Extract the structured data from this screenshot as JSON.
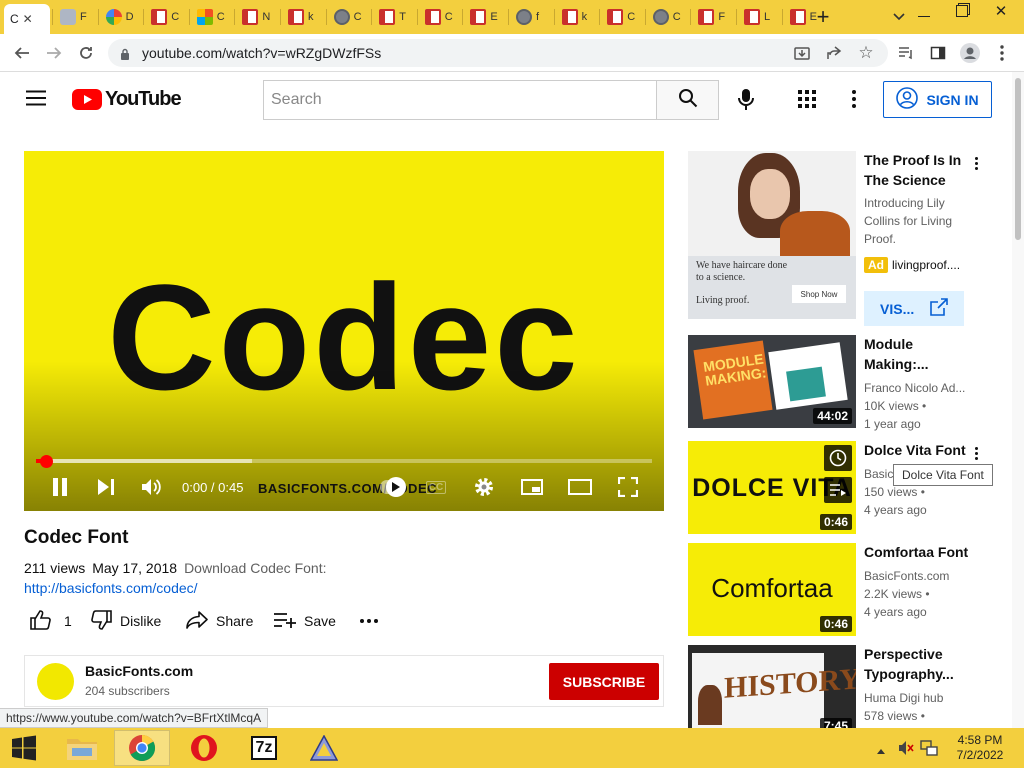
{
  "browser": {
    "url": "youtube.com/watch?v=wRZgDWzfFSs",
    "active_tab_label": "C",
    "tabs": [
      {
        "icon": "doc",
        "letter": "F"
      },
      {
        "icon": "g",
        "letter": "D"
      },
      {
        "icon": "red",
        "letter": "C"
      },
      {
        "icon": "tile",
        "letter": "C"
      },
      {
        "icon": "red",
        "letter": "N"
      },
      {
        "icon": "red",
        "letter": "k"
      },
      {
        "icon": "globe",
        "letter": "C"
      },
      {
        "icon": "red",
        "letter": "T"
      },
      {
        "icon": "red",
        "letter": "C"
      },
      {
        "icon": "red",
        "letter": "E"
      },
      {
        "icon": "globe",
        "letter": "f"
      },
      {
        "icon": "red",
        "letter": "k"
      },
      {
        "icon": "red",
        "letter": "C"
      },
      {
        "icon": "globe",
        "letter": "C"
      },
      {
        "icon": "red",
        "letter": "F"
      },
      {
        "icon": "red",
        "letter": "L"
      },
      {
        "icon": "red",
        "letter": "E"
      }
    ]
  },
  "header": {
    "logo_text": "YouTube",
    "search_placeholder": "Search",
    "sign_in": "SIGN IN"
  },
  "player": {
    "title_art": "Codec",
    "time": "0:00 / 0:45",
    "watermark": "BASICFONTS.COM/CODEC",
    "cc": "CC",
    "progress_played_fraction": 0.016,
    "progress_buffered_fraction": 0.35
  },
  "video": {
    "title": "Codec Font",
    "views": "211 views",
    "date": "May 17, 2018",
    "description": "Download Codec Font:",
    "link": "http://basicfonts.com/codec/",
    "likes": "1",
    "dislike": "Dislike",
    "share": "Share",
    "save": "Save"
  },
  "channel": {
    "name": "BasicFonts.com",
    "subscribers": "204 subscribers",
    "subscribe": "SUBSCRIBE"
  },
  "sidebar": {
    "ad": {
      "title": "The Proof Is In The Science",
      "description": "Introducing Lily Collins for Living Proof.",
      "badge": "Ad",
      "advertiser": "livingproof....",
      "visit": "VIS...",
      "thumb_text_1": "We have haircare done to a science.",
      "thumb_text_2": "Living proof.",
      "thumb_cta": "Shop Now"
    },
    "videos": [
      {
        "title": "Module Making:...",
        "channel": "Franco Nicolo Ad...",
        "views": "10K views •",
        "age": "1 year ago",
        "duration": "44:02",
        "thumb_text": "MODULE MAKING:"
      },
      {
        "title": "Dolce Vita Font",
        "channel": "Basic...",
        "views": "150 views •",
        "age": "4 years ago",
        "duration": "0:46",
        "thumb_text": "DOLCE VITA"
      },
      {
        "title": "Comfortaa Font",
        "channel": "BasicFonts.com",
        "views": "2.2K views •",
        "age": "4 years ago",
        "duration": "0:46",
        "thumb_text": "Comfortaa"
      },
      {
        "title": "Perspective Typography...",
        "channel": "Huma Digi hub",
        "views": "578 views •",
        "age": "",
        "duration": "7:45",
        "thumb_text": "HISTORY"
      }
    ],
    "tooltip": "Dolce Vita Font"
  },
  "status_url": "https://www.youtube.com/watch?v=BFrtXtlMcqA",
  "taskbar": {
    "time": "4:58 PM",
    "date": "7/2/2022"
  },
  "colors": {
    "chrome": "#f3cf3e",
    "yt_red": "#ff0000",
    "video_bg": "#f6ec06",
    "link": "#065fd4"
  }
}
